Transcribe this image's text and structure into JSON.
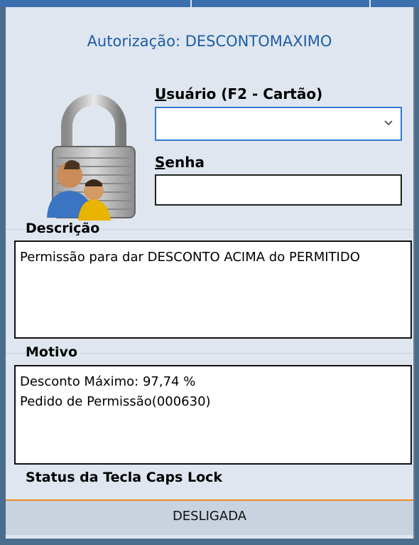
{
  "dialog": {
    "title": "Autorização: DESCONTOMAXIMO",
    "user_label_access": "U",
    "user_label_rest": "suário (F2 - Cartão)",
    "user_value": "",
    "password_label_access": "S",
    "password_label_rest": "enha",
    "password_value": ""
  },
  "description": {
    "heading": "Descrição",
    "text": "Permissão para dar DESCONTO ACIMA do PERMITIDO"
  },
  "reason": {
    "heading": "Motivo",
    "line1": "Desconto Máximo: 97,74 %",
    "line2": "Pedido de Permissão(000630)"
  },
  "caps_lock": {
    "heading": "Status da Tecla Caps Lock",
    "status": "DESLIGADA"
  },
  "icons": {
    "lock": "lock-users-icon",
    "dropdown": "chevron-down-icon"
  },
  "colors": {
    "accent": "#1d5da6",
    "focus_border": "#2f7ad3",
    "status_border": "#f08a24",
    "panel": "#dfe6ef"
  }
}
